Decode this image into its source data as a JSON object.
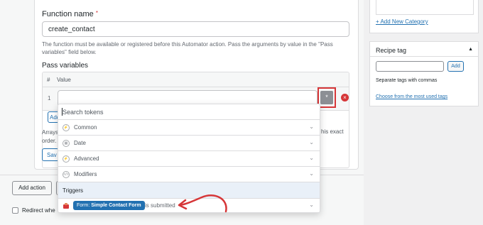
{
  "action": {
    "function_name_label": "Function name",
    "required_mark": "*",
    "function_name_value": "create_contact",
    "helptext": "The function must be available or registered before this Automator action. Pass the arguments by value in the \"Pass variables\" field below.",
    "pass_variables_label": "Pass variables",
    "table": {
      "col_num": "#",
      "col_value": "Value",
      "rows": [
        {
          "num": "1",
          "value": ""
        }
      ]
    },
    "token_button_glyph": "*",
    "add_button_partial": "Add",
    "array_text_left": "Arrays order.",
    "array_text_right": "his exact",
    "save_button_partial": "Sav"
  },
  "footer": {
    "add_action_label": "Add action",
    "redirect_label": "Redirect whe"
  },
  "token_dropdown": {
    "search_placeholder": "Search tokens",
    "groups": [
      {
        "label": "Common",
        "icon": "bolt-icon"
      },
      {
        "label": "Date",
        "icon": "calendar-icon"
      },
      {
        "label": "Advanced",
        "icon": "bolt-icon"
      },
      {
        "label": "Modifiers",
        "icon": "code-icon"
      }
    ],
    "triggers_label": "Triggers",
    "trigger_item": {
      "badge_prefix": "Form:",
      "badge_name": "Simple Contact Form",
      "suffix": "is submitted"
    }
  },
  "sidebar": {
    "add_category_link": "+ Add New Category",
    "recipe_tag": {
      "title": "Recipe tag",
      "add_button": "Add",
      "help": "Separate tags with commas",
      "choose_link": "Choose from the most used tags"
    }
  },
  "colors": {
    "accent": "#2271b1",
    "danger": "#d63638",
    "triggers_bg": "#e9f0f8"
  }
}
